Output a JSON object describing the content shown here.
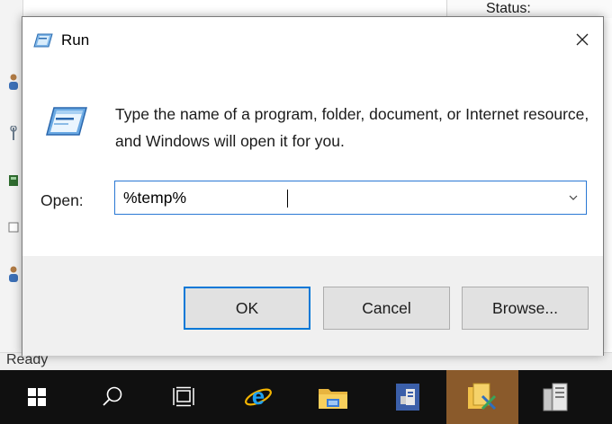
{
  "background_window": {
    "status_label": "Status:",
    "statusbar_text": "Ready"
  },
  "dialog": {
    "title": "Run",
    "icon": "run-icon",
    "prompt": "Type the name of a program, folder, document, or Internet resource, and Windows will open it for you.",
    "open_label": "Open:",
    "open_value": "%temp%",
    "buttons": {
      "ok": "OK",
      "cancel": "Cancel",
      "browse": "Browse..."
    }
  },
  "taskbar": {
    "items": [
      {
        "icon": "windows-start-icon"
      },
      {
        "icon": "search-icon"
      },
      {
        "icon": "task-view-icon"
      },
      {
        "icon": "internet-explorer-icon"
      },
      {
        "icon": "file-explorer-icon"
      },
      {
        "icon": "server-manager-icon"
      },
      {
        "icon": "tools-icon",
        "active": true
      },
      {
        "icon": "server-icon"
      }
    ]
  },
  "colors": {
    "accent": "#0078d7",
    "taskbar_bg": "#101010",
    "taskbar_active": "#8a5a2b",
    "footer_bg": "#f0f0f0"
  }
}
